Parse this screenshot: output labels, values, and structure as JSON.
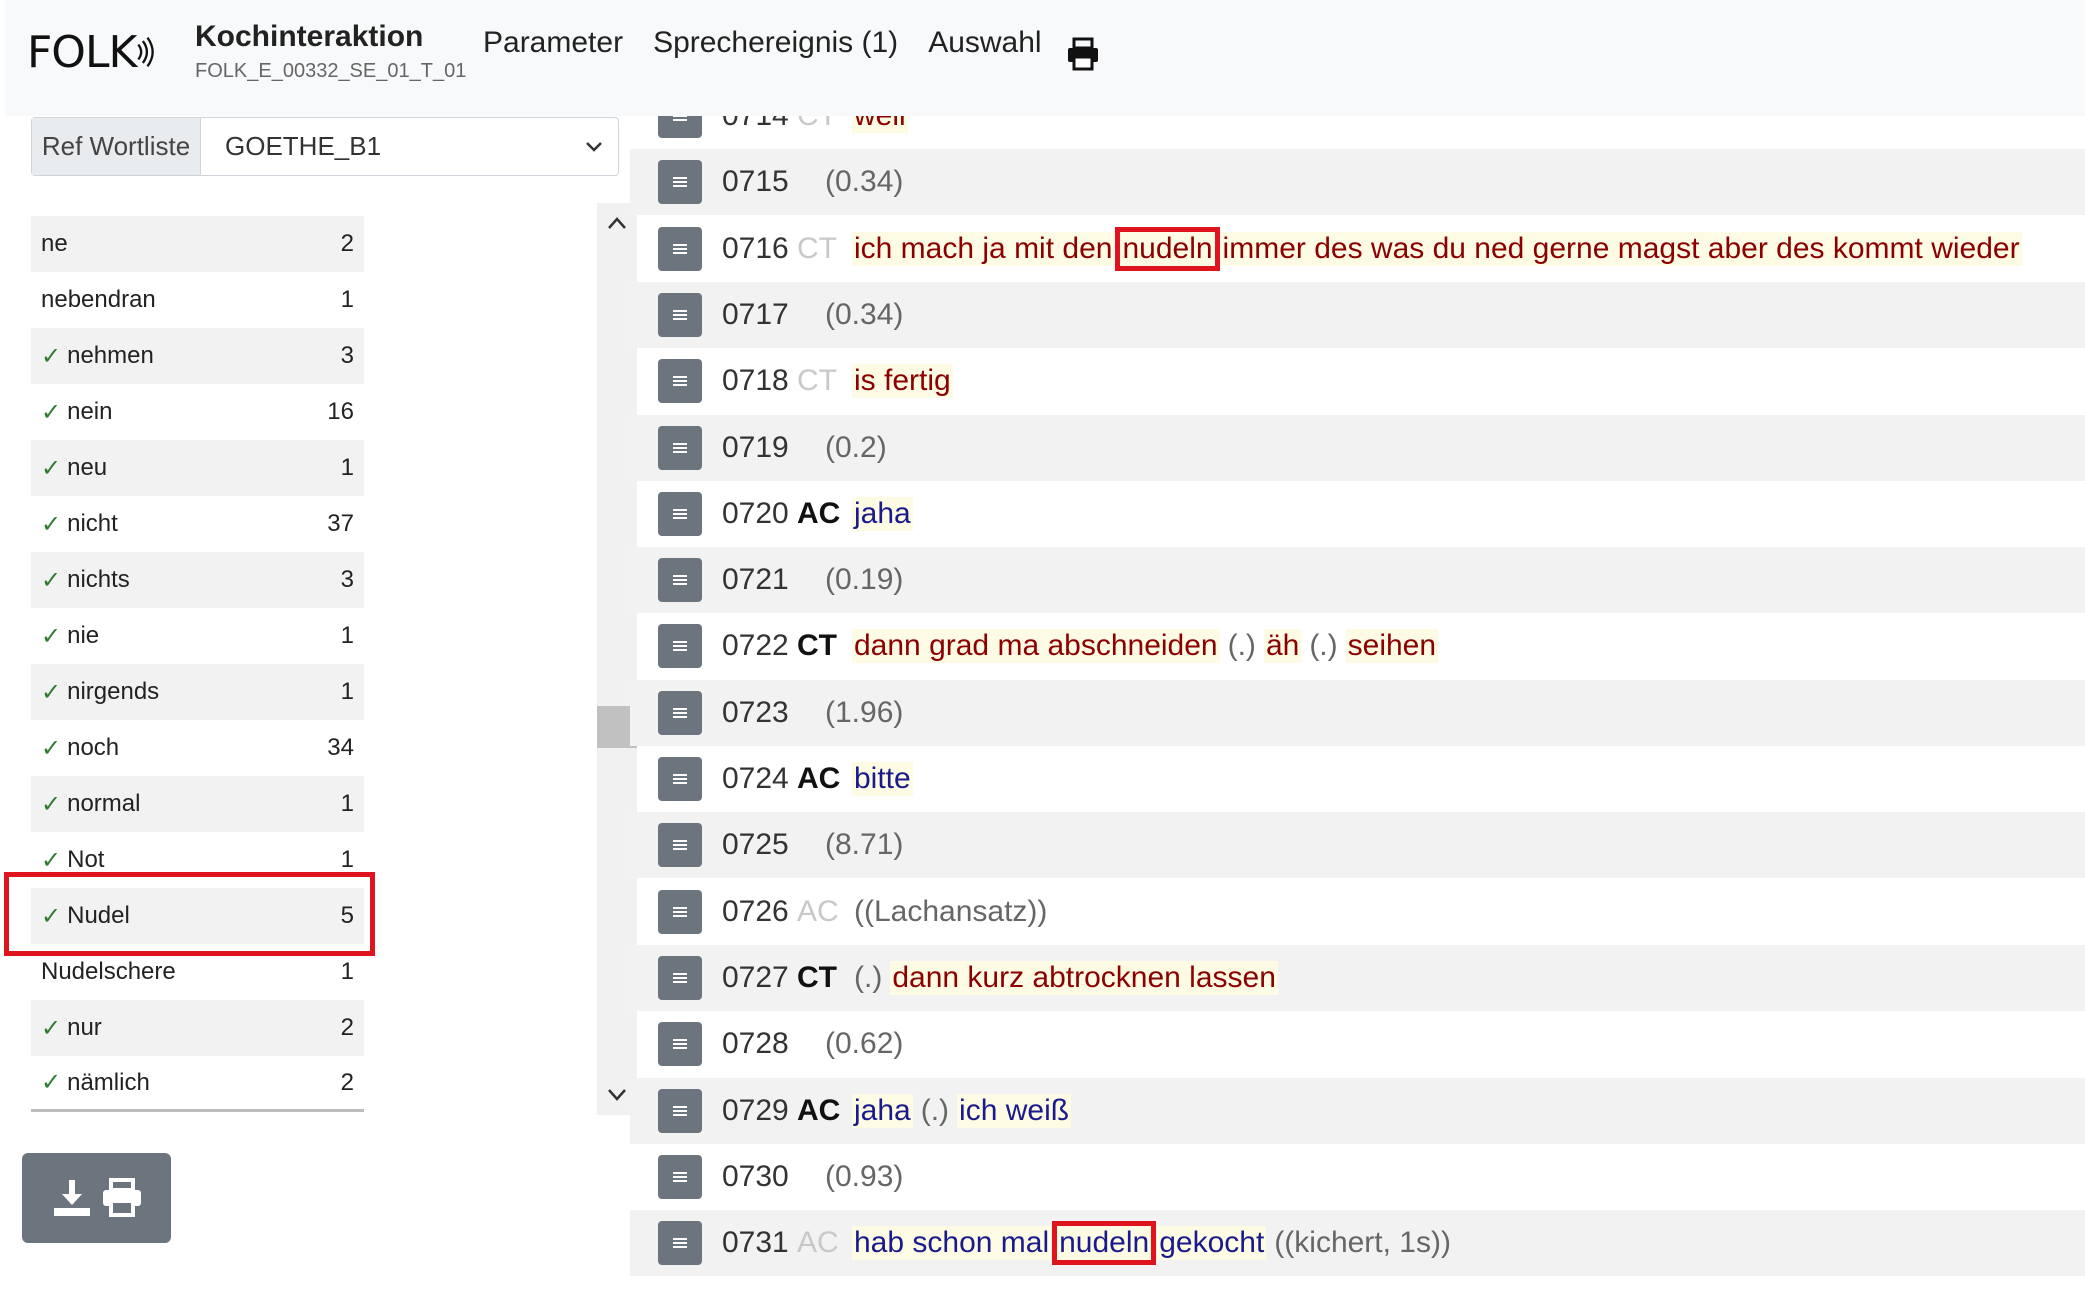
{
  "header": {
    "logo": "FOLK",
    "title": "Kochinteraktion",
    "subtitle": "FOLK_E_00332_SE_01_T_01",
    "nav": [
      "Parameter",
      "Sprechereignis (1)",
      "Auswahl"
    ],
    "print_icon": "printer-icon"
  },
  "wordlist": {
    "prefix": "Ref Wortliste",
    "selected": "GOETHE_B1"
  },
  "words": [
    {
      "word": "ne",
      "count": "2",
      "checked": false
    },
    {
      "word": "nebendran",
      "count": "1",
      "checked": false
    },
    {
      "word": "nehmen",
      "count": "3",
      "checked": true
    },
    {
      "word": "nein",
      "count": "16",
      "checked": true
    },
    {
      "word": "neu",
      "count": "1",
      "checked": true
    },
    {
      "word": "nicht",
      "count": "37",
      "checked": true
    },
    {
      "word": "nichts",
      "count": "3",
      "checked": true
    },
    {
      "word": "nie",
      "count": "1",
      "checked": true
    },
    {
      "word": "nirgends",
      "count": "1",
      "checked": true
    },
    {
      "word": "noch",
      "count": "34",
      "checked": true
    },
    {
      "word": "normal",
      "count": "1",
      "checked": true
    },
    {
      "word": "Not",
      "count": "1",
      "checked": true
    },
    {
      "word": "Nudel",
      "count": "5",
      "checked": true
    },
    {
      "word": "Nudelschere",
      "count": "1",
      "checked": false
    },
    {
      "word": "nur",
      "count": "2",
      "checked": true
    },
    {
      "word": "nämlich",
      "count": "2",
      "checked": true
    }
  ],
  "check_mark": "✓",
  "download": {
    "icons": [
      "download-icon",
      "printer-icon"
    ]
  },
  "transcript": [
    {
      "no": "0714",
      "spk": "CT",
      "spk_style": "grey",
      "type": "ct",
      "tokens": [
        "weil"
      ]
    },
    {
      "no": "0715",
      "spk": "",
      "type": "pause",
      "pause": "(0.34)"
    },
    {
      "no": "0716",
      "spk": "CT",
      "spk_style": "grey",
      "type": "ct",
      "tokens": [
        "ich mach ja mit den",
        "nudeln",
        "immer des was du ned gerne magst aber des kommt wieder"
      ],
      "hl": 1
    },
    {
      "no": "0717",
      "spk": "",
      "type": "pause",
      "pause": "(0.34)"
    },
    {
      "no": "0718",
      "spk": "CT",
      "spk_style": "grey",
      "type": "ct",
      "tokens": [
        "is fertig"
      ]
    },
    {
      "no": "0719",
      "spk": "",
      "type": "pause",
      "pause": "(0.2)"
    },
    {
      "no": "0720",
      "spk": "AC",
      "spk_style": "bold",
      "type": "ac",
      "tokens": [
        "jaha"
      ]
    },
    {
      "no": "0721",
      "spk": "",
      "type": "pause",
      "pause": "(0.19)"
    },
    {
      "no": "0722",
      "spk": "CT",
      "spk_style": "bold",
      "type": "ct",
      "tokens": [
        "dann grad ma abschneiden",
        "(.)",
        "äh",
        "(.)",
        "seihen"
      ],
      "grey_idx": [
        1,
        3
      ]
    },
    {
      "no": "0723",
      "spk": "",
      "type": "pause",
      "pause": "(1.96)"
    },
    {
      "no": "0724",
      "spk": "AC",
      "spk_style": "bold",
      "type": "ac",
      "tokens": [
        "bitte"
      ]
    },
    {
      "no": "0725",
      "spk": "",
      "type": "pause",
      "pause": "(8.71)"
    },
    {
      "no": "0726",
      "spk": "AC",
      "spk_style": "grey",
      "type": "ac",
      "tokens": [
        "((Lachansatz))"
      ],
      "grey_idx": [
        0
      ]
    },
    {
      "no": "0727",
      "spk": "CT",
      "spk_style": "bold",
      "type": "ct",
      "tokens": [
        "(.)",
        "dann kurz abtrocknen lassen"
      ],
      "grey_idx": [
        0
      ]
    },
    {
      "no": "0728",
      "spk": "",
      "type": "pause",
      "pause": "(0.62)"
    },
    {
      "no": "0729",
      "spk": "AC",
      "spk_style": "bold",
      "type": "ac",
      "tokens": [
        "jaha",
        "(.)",
        "ich weiß"
      ],
      "grey_idx": [
        1
      ]
    },
    {
      "no": "0730",
      "spk": "",
      "type": "pause",
      "pause": "(0.93)"
    },
    {
      "no": "0731",
      "spk": "AC",
      "spk_style": "grey",
      "type": "ac",
      "tokens": [
        "hab schon mal",
        "nudeln",
        "gekocht",
        "((kichert, 1s))"
      ],
      "hl": 1,
      "grey_idx": [
        3
      ]
    }
  ]
}
